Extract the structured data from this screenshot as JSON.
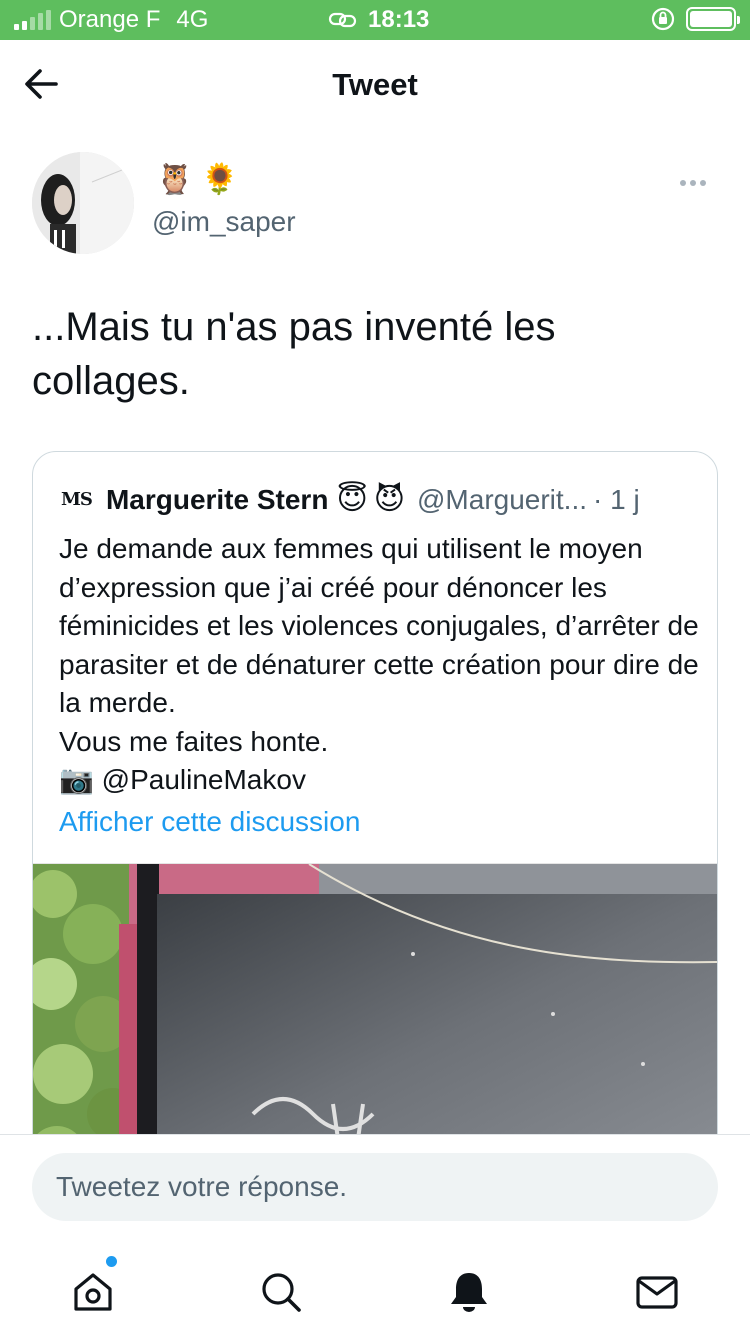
{
  "status_bar": {
    "carrier": "Orange F",
    "network": "4G",
    "time": "18:13"
  },
  "header": {
    "title": "Tweet"
  },
  "tweet": {
    "author_emojis": "🦉🌻",
    "handle": "@im_saper",
    "text": "...Mais tu n'as pas inventé les collages."
  },
  "quoted_tweet": {
    "logo": "MS",
    "name": "Marguerite Stern",
    "emoji_1": "😇",
    "emoji_2": "😈",
    "handle": "@Marguerit...",
    "separator_time": "· 1 j",
    "text": "Je demande aux femmes qui utilisent le moyen d’expression que j’ai créé pour dénoncer les féminicides et les violences conjugales, d’arrêter de parasiter et de dénaturer cette création pour dire de la merde.\nVous me faites honte.\n📷 @PaulineMakov",
    "show_thread": "Afficher cette discussion"
  },
  "reply": {
    "placeholder": "Tweetez votre réponse."
  },
  "tabbar": {
    "items": [
      "home-icon",
      "search-icon",
      "notifications-icon",
      "messages-icon"
    ],
    "accent": "#1d9bf0"
  },
  "colors": {
    "status_bar": "#5ebe5e",
    "link": "#1d9bf0",
    "secondary_text": "#536471"
  }
}
